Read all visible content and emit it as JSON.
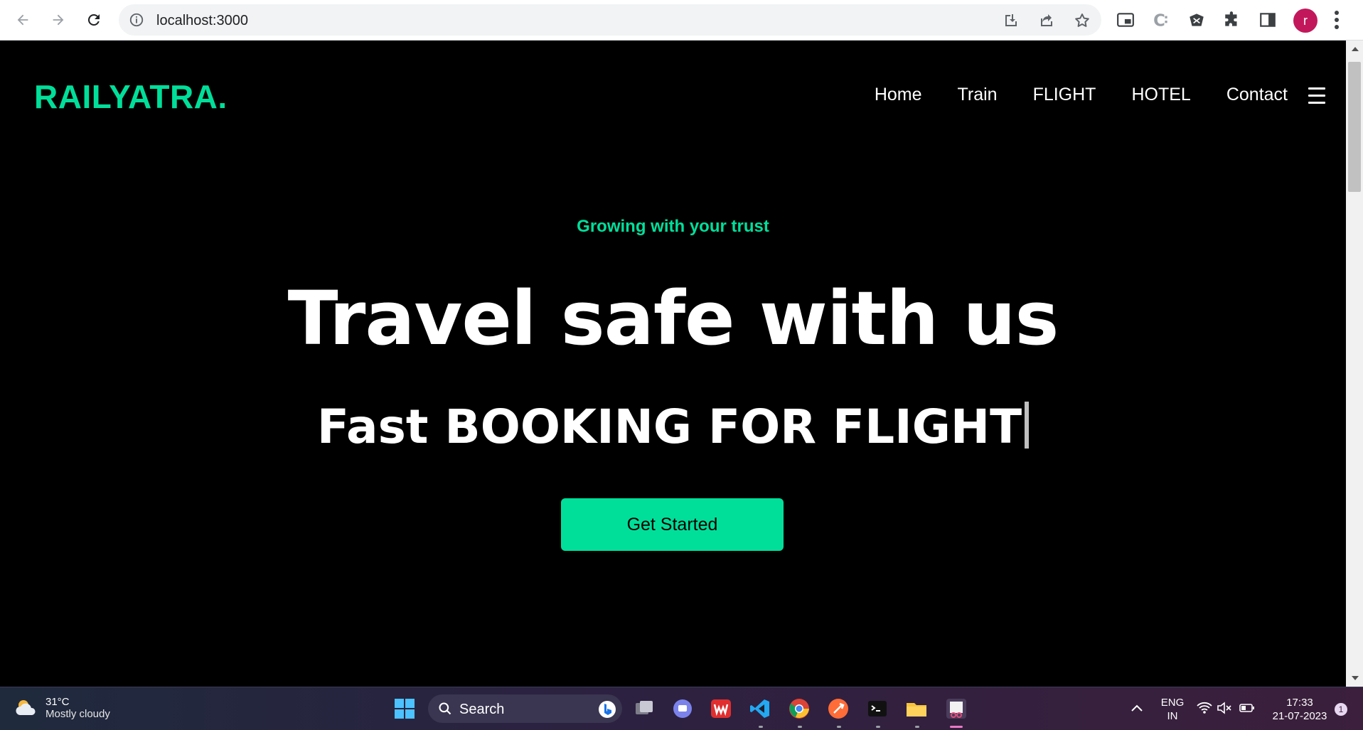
{
  "browser": {
    "url": "localhost:3000",
    "avatar_letter": "r",
    "avatar_color": "#c2185b"
  },
  "site": {
    "logo": "RAILYATRA.",
    "accent_color": "#00df9a",
    "nav": [
      "Home",
      "Train",
      "FLIGHT",
      "HOTEL",
      "Contact"
    ],
    "tagline": "Growing with your trust",
    "hero_title": "Travel safe with us",
    "hero_subtitle": "Fast BOOKING FOR FLIGHT",
    "cta_label": "Get Started"
  },
  "taskbar": {
    "weather_temp": "31°C",
    "weather_desc": "Mostly cloudy",
    "search_label": "Search",
    "lang_line1": "ENG",
    "lang_line2": "IN",
    "time": "17:33",
    "date": "21-07-2023",
    "notification_count": "1",
    "apps": [
      "start-icon",
      "search-icon",
      "bing-icon",
      "task-view-icon",
      "teams-chat-icon",
      "wps-office-icon",
      "vscode-icon",
      "chrome-icon",
      "postman-icon",
      "terminal-icon",
      "file-explorer-icon",
      "snipping-tool-icon"
    ]
  }
}
